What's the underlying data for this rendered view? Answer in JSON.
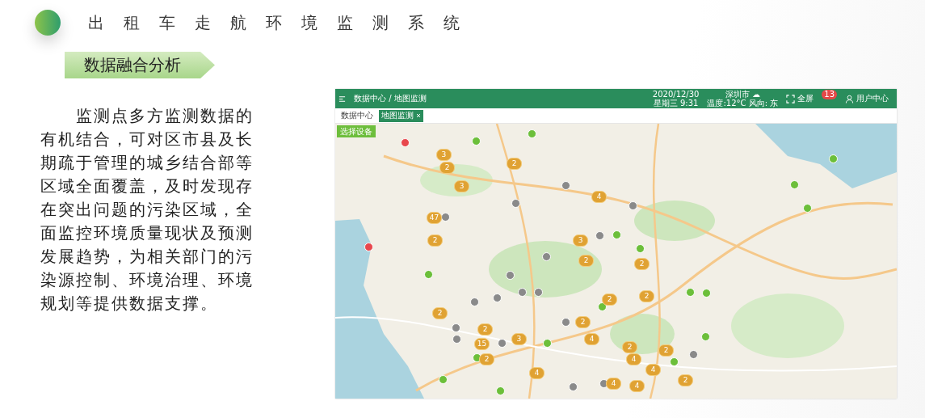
{
  "header": {
    "title": "出租车走航环境监测系统"
  },
  "section": {
    "label": "数据融合分析"
  },
  "description": "监测点多方监测数据的有机结合，可对区市县及长期疏于管理的城乡结合部等区域全面覆盖，及时发现存在突出问题的污染区域，全面监控环境质量现状及预测发展趋势，为相关部门的污染源控制、环境治理、环境规划等提供数据支撑。",
  "app": {
    "breadcrumb": "数据中心 / 地图监测",
    "date": "2020/12/30",
    "time": "星期三 9:31",
    "city": "深圳市 ☁",
    "weather": "温度:12°C 风向: 东",
    "fullscreen": "全屏",
    "badge": "13",
    "user": "用户中心",
    "tabs": [
      {
        "label": "数据中心",
        "selected": false
      },
      {
        "label": "地图监测",
        "selected": true,
        "closable": true
      }
    ],
    "select_button": "选择设备",
    "clusters": [
      {
        "count": "3"
      },
      {
        "count": "2"
      },
      {
        "count": "2"
      },
      {
        "count": "3"
      },
      {
        "count": "4"
      },
      {
        "count": "47"
      },
      {
        "count": "2"
      },
      {
        "count": "3"
      },
      {
        "count": "2"
      },
      {
        "count": "2"
      },
      {
        "count": "2"
      },
      {
        "count": "2"
      },
      {
        "count": "2"
      },
      {
        "count": "2"
      },
      {
        "count": "2"
      },
      {
        "count": "3"
      },
      {
        "count": "4"
      },
      {
        "count": "15"
      },
      {
        "count": "2"
      },
      {
        "count": "2"
      },
      {
        "count": "4"
      },
      {
        "count": "2"
      },
      {
        "count": "4"
      },
      {
        "count": "4"
      },
      {
        "count": "2"
      },
      {
        "count": "4"
      },
      {
        "count": "4"
      }
    ],
    "points": [
      {
        "color": "#6cbf3a"
      },
      {
        "color": "#6cbf3a"
      },
      {
        "color": "#6cbf3a"
      },
      {
        "color": "#6cbf3a"
      },
      {
        "color": "#6cbf3a"
      },
      {
        "color": "#6cbf3a"
      },
      {
        "color": "#6cbf3a"
      },
      {
        "color": "#6cbf3a"
      },
      {
        "color": "#6cbf3a"
      },
      {
        "color": "#6cbf3a"
      },
      {
        "color": "#6cbf3a"
      },
      {
        "color": "#6cbf3a"
      },
      {
        "color": "#6cbf3a"
      },
      {
        "color": "#6cbf3a"
      },
      {
        "color": "#6cbf3a"
      },
      {
        "color": "#6cbf3a"
      },
      {
        "color": "#6cbf3a"
      },
      {
        "color": "#8a8a8a"
      },
      {
        "color": "#8a8a8a"
      },
      {
        "color": "#8a8a8a"
      },
      {
        "color": "#8a8a8a"
      },
      {
        "color": "#8a8a8a"
      },
      {
        "color": "#8a8a8a"
      },
      {
        "color": "#8a8a8a"
      },
      {
        "color": "#8a8a8a"
      },
      {
        "color": "#8a8a8a"
      },
      {
        "color": "#8a8a8a"
      },
      {
        "color": "#8a8a8a"
      },
      {
        "color": "#8a8a8a"
      },
      {
        "color": "#8a8a8a"
      },
      {
        "color": "#8a8a8a"
      },
      {
        "color": "#8a8a8a"
      },
      {
        "color": "#8a8a8a"
      },
      {
        "color": "#8a8a8a"
      },
      {
        "color": "#8a8a8a"
      },
      {
        "color": "#e8474d"
      },
      {
        "color": "#e8474d"
      }
    ]
  }
}
